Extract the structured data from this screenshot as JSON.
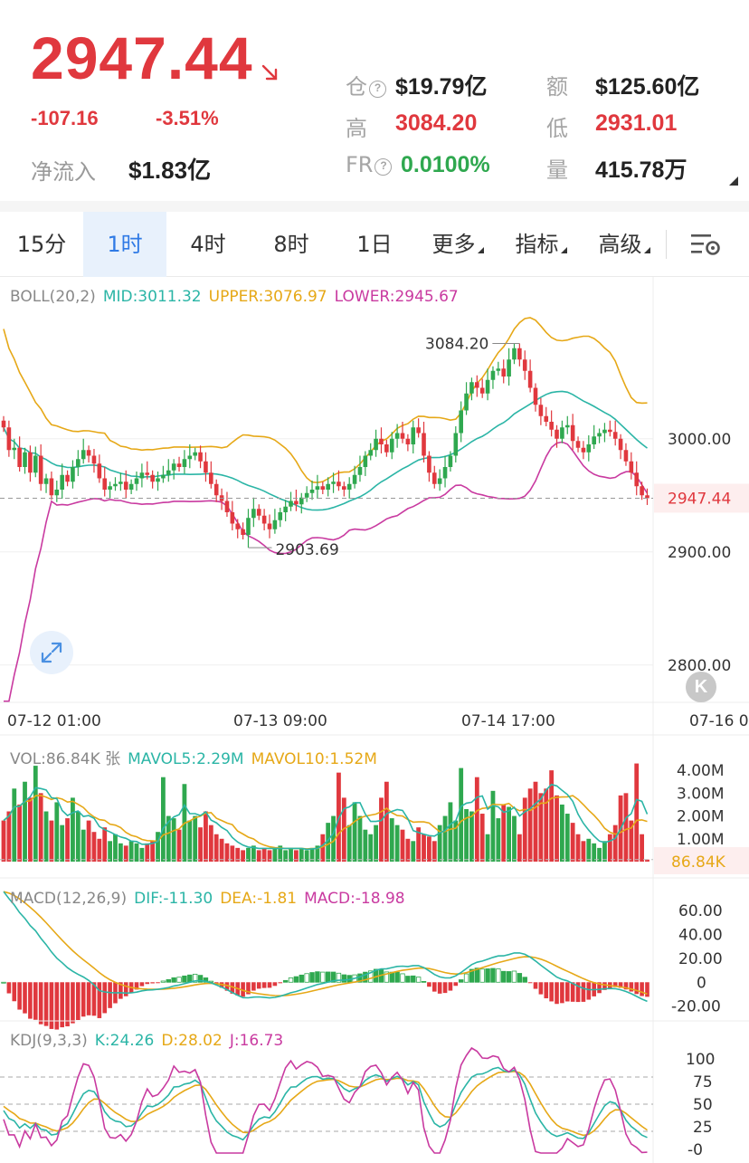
{
  "header": {
    "price": "2947.44",
    "change": "-107.16",
    "change_pct": "-3.51%",
    "net_inflow_label": "净流入",
    "net_inflow_value": "$1.83亿",
    "stats": {
      "oi_label": "仓",
      "oi_value": "$19.79亿",
      "turnover_label": "额",
      "turnover_value": "$125.60亿",
      "high_label": "高",
      "high_value": "3084.20",
      "low_label": "低",
      "low_value": "2931.01",
      "fr_label": "FR",
      "fr_value": "0.0100%",
      "volume_label": "量",
      "volume_value": "415.78万"
    },
    "colors": {
      "down": "#e0383e",
      "up": "#2fa84f",
      "muted": "#9a9a9a"
    }
  },
  "tabs": {
    "items": [
      {
        "label": "15分",
        "active": false,
        "dropdown": false
      },
      {
        "label": "1时",
        "active": true,
        "dropdown": false
      },
      {
        "label": "4时",
        "active": false,
        "dropdown": false
      },
      {
        "label": "8时",
        "active": false,
        "dropdown": false
      },
      {
        "label": "1日",
        "active": false,
        "dropdown": false
      },
      {
        "label": "更多",
        "active": false,
        "dropdown": true
      },
      {
        "label": "指标",
        "active": false,
        "dropdown": true
      },
      {
        "label": "高级",
        "active": false,
        "dropdown": true
      }
    ],
    "settings_icon": "chart-settings-icon"
  },
  "indicators": {
    "boll": {
      "name": "BOLL(20,2)",
      "mid": "MID:3011.32",
      "upper": "UPPER:3076.97",
      "lower": "LOWER:2945.67"
    },
    "vol": {
      "name": "VOL:86.84K 张",
      "ma5": "MAVOL5:2.29M",
      "ma10": "MAVOL10:1.52M"
    },
    "macd": {
      "name": "MACD(12,26,9)",
      "dif": "DIF:-11.30",
      "dea": "DEA:-1.81",
      "macd": "MACD:-18.98"
    },
    "kdj": {
      "name": "KDJ(9,3,3)",
      "k": "K:24.26",
      "d": "D:28.02",
      "j": "J:16.73"
    }
  },
  "chart_data": [
    {
      "type": "candlestick",
      "title": "BOLL(20,2)",
      "x_tick_labels": [
        "07-12 01:00",
        "07-13 09:00",
        "07-14 17:00",
        "07-16 0"
      ],
      "y_tick_labels": [
        "3000.00",
        "2900.00",
        "2800.00"
      ],
      "ylim": [
        2767,
        3127
      ],
      "current_price": 2947.44,
      "annotations": {
        "high": 3084.2,
        "low": 2903.69
      },
      "boll": {
        "mid": 3011.32,
        "upper": 3076.97,
        "lower": 2945.67
      },
      "close": [
        3010,
        2990,
        2992,
        2975,
        2988,
        2970,
        2985,
        2960,
        2965,
        2950,
        2955,
        2968,
        2962,
        2975,
        2982,
        2990,
        2985,
        2978,
        2965,
        2955,
        2958,
        2960,
        2962,
        2955,
        2960,
        2965,
        2970,
        2968,
        2962,
        2965,
        2968,
        2972,
        2978,
        2975,
        2982,
        2985,
        2988,
        2980,
        2970,
        2960,
        2950,
        2945,
        2935,
        2925,
        2920,
        2915,
        2930,
        2938,
        2932,
        2925,
        2920,
        2928,
        2935,
        2940,
        2945,
        2942,
        2948,
        2952,
        2955,
        2958,
        2955,
        2960,
        2962,
        2958,
        2955,
        2960,
        2968,
        2975,
        2985,
        2990,
        3000,
        2995,
        2988,
        3000,
        3005,
        3000,
        2995,
        3010,
        3005,
        2985,
        2970,
        2960,
        2965,
        2975,
        2985,
        3005,
        3025,
        3040,
        3050,
        3045,
        3040,
        3052,
        3060,
        3062,
        3055,
        3070,
        3080,
        3070,
        3060,
        3045,
        3030,
        3020,
        3015,
        3008,
        3000,
        3010,
        3012,
        2998,
        2992,
        2988,
        2995,
        3002,
        3005,
        3008,
        3006,
        3000,
        2990,
        2980,
        2970,
        2958,
        2950,
        2947.44
      ],
      "high_tick_labels": [
        "3084.20"
      ],
      "low_tick_labels": [
        "2903.69"
      ]
    },
    {
      "type": "bar",
      "title": "VOL",
      "y_tick_labels": [
        "4.00M",
        "3.00M",
        "2.00M",
        "1.00M"
      ],
      "current_label": "86.84K",
      "ylim": [
        0,
        4.6
      ],
      "values": [
        1.8,
        2.2,
        3.2,
        2.5,
        3.5,
        2.8,
        4.2,
        3.0,
        2.2,
        1.8,
        2.6,
        1.6,
        1.9,
        2.8,
        2.2,
        1.4,
        1.8,
        1.3,
        1.0,
        1.5,
        0.9,
        1.2,
        0.8,
        0.7,
        0.9,
        0.8,
        0.6,
        0.8,
        0.9,
        1.3,
        3.7,
        2.0,
        1.9,
        1.4,
        3.4,
        1.8,
        2.0,
        1.5,
        2.2,
        1.6,
        1.2,
        1.0,
        0.8,
        0.7,
        0.6,
        0.5,
        0.6,
        0.7,
        0.5,
        0.6,
        0.5,
        0.6,
        0.7,
        0.5,
        0.6,
        0.5,
        0.6,
        0.5,
        0.6,
        0.7,
        1.2,
        1.7,
        2.0,
        3.9,
        2.8,
        1.6,
        2.6,
        2.0,
        1.4,
        1.2,
        1.6,
        2.8,
        3.5,
        1.9,
        1.6,
        1.4,
        1.0,
        0.9,
        1.5,
        1.2,
        1.1,
        0.9,
        1.6,
        2.0,
        2.6,
        1.8,
        4.1,
        2.3,
        2.2,
        3.7,
        2.1,
        1.2,
        3.1,
        1.9,
        2.5,
        2.4,
        2.0,
        1.2,
        2.8,
        3.2,
        3.5,
        3.0,
        3.2,
        4.0,
        2.9,
        2.5,
        2.1,
        1.7,
        1.2,
        0.9,
        1.0,
        0.8,
        0.6,
        0.9,
        1.2,
        1.6,
        2.9,
        3.0,
        1.8,
        4.3,
        1.2,
        0.09
      ],
      "ma5": 2.29,
      "ma10": 1.52,
      "last": 0.08684
    },
    {
      "type": "bar",
      "title": "MACD(12,26,9)",
      "y_tick_labels": [
        "60.00",
        "40.00",
        "20.00",
        "0",
        "-20.00"
      ],
      "ylim": [
        -27,
        72
      ],
      "dif": -11.3,
      "dea": -1.81,
      "macd": -18.98
    },
    {
      "type": "line",
      "title": "KDJ(9,3,3)",
      "y_tick_labels": [
        "100",
        "75",
        "50",
        "25",
        "-0"
      ],
      "ylim": [
        -4,
        114
      ],
      "k": 24.26,
      "d": 28.02,
      "j": 16.73
    }
  ]
}
